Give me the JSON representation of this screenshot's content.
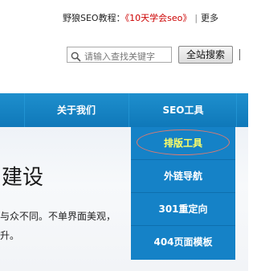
{
  "header": {
    "promo_prefix": "野狼SEO教程：",
    "promo_link": "《10天学会seo》",
    "separator": "|",
    "more_label": "更多"
  },
  "search": {
    "placeholder": "请输入查找关键字",
    "button_label": "全站搜索"
  },
  "nav": {
    "items": [
      {
        "label": "关于我们"
      },
      {
        "label": "SEO工具"
      }
    ]
  },
  "dropdown": {
    "items": [
      {
        "label": "排版工具",
        "active": true
      },
      {
        "label": "外链导航"
      },
      {
        "label": "301重定向"
      },
      {
        "label": "404页面模板"
      }
    ]
  },
  "content": {
    "heading": "建设",
    "body_line1": "与众不同。不单界面美观，",
    "body_line2": "升。"
  },
  "colors": {
    "nav_bg": "#1582c7",
    "active_item": "#ffff66",
    "promo_link": "#cc0000",
    "highlight_ring": "#e07a6e"
  }
}
